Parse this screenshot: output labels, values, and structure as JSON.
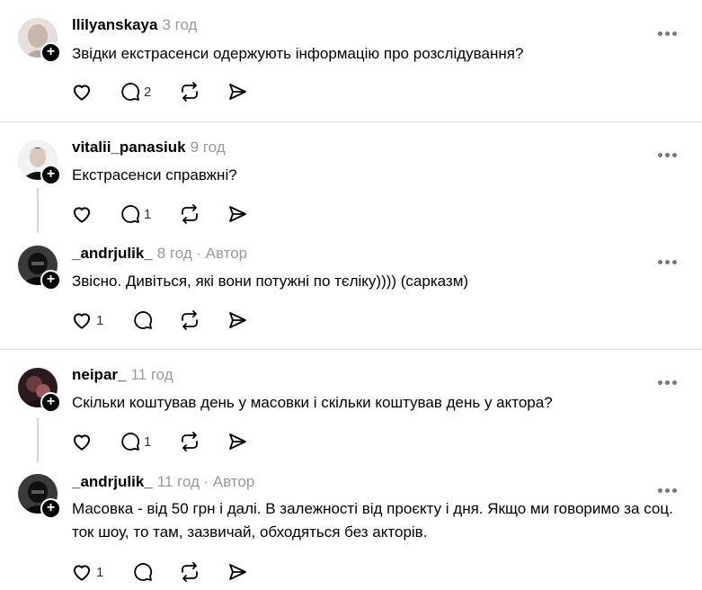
{
  "comments": [
    {
      "username": "llilyanskaya",
      "time": "3 год",
      "author": "",
      "text": "Звідки екстрасенси одержують інформацію про розслідування?",
      "likes": "",
      "replies": "2"
    },
    {
      "username": "vitalii_panasiuk",
      "time": "9 год",
      "author": "",
      "text": "Екстрасенси справжні?",
      "likes": "",
      "replies": "1"
    },
    {
      "username": "_andrjulik_",
      "time": "8 год",
      "author": "· Автор",
      "text": "Звісно. Дивіться, які вони потужні по тєліку)))) (сарказм)",
      "likes": "1",
      "replies": ""
    },
    {
      "username": "neipar_",
      "time": "11 год",
      "author": "",
      "text": "Скільки коштував день у масовки і скільки коштував день у актора?",
      "likes": "",
      "replies": "1"
    },
    {
      "username": "_andrjulik_",
      "time": "11 год",
      "author": "· Автор",
      "text": "Масовка - від 50 грн і далі. В залежності від проєкту і дня. Якщо ми говоримо за соц. ток шоу, то там, зазвичай, обходяться без акторів.",
      "likes": "1",
      "replies": ""
    }
  ],
  "icons": {
    "like": "heart-icon",
    "reply": "comment-icon",
    "repost": "repost-icon",
    "share": "share-icon",
    "more": "more-icon",
    "follow": "plus-icon"
  }
}
